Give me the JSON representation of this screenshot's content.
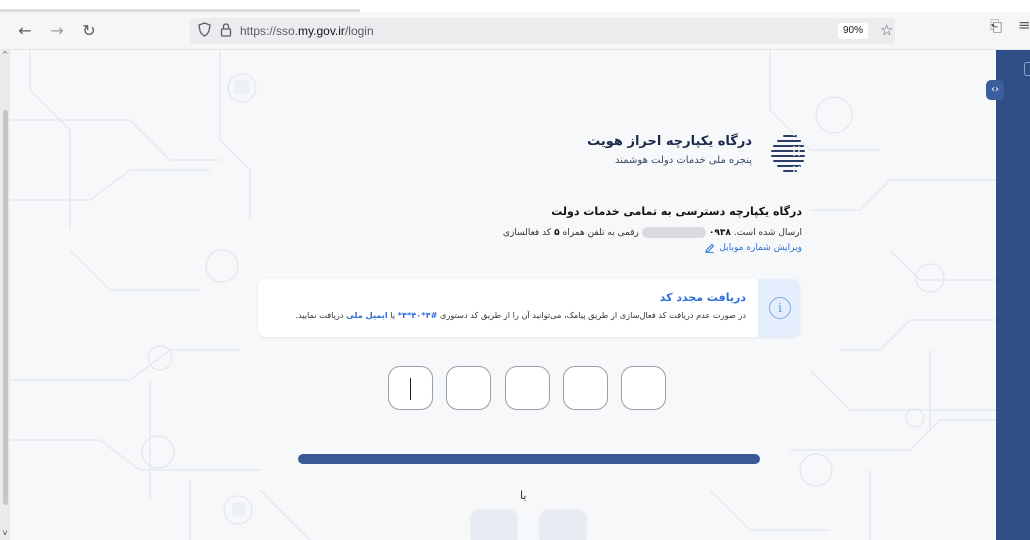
{
  "browser": {
    "url_prefix": "https://sso.",
    "url_domain": "my.gov.ir",
    "url_path": "/login",
    "zoom": "90%",
    "icons": {
      "back": "arrow-left-icon",
      "forward": "arrow-right-icon",
      "reload": "reload-icon",
      "shield": "shield-icon",
      "lock": "lock-icon",
      "bookmark": "star-icon",
      "extensions": "extensions-icon",
      "menu": "menu-icon"
    }
  },
  "brand": {
    "title": "درگاه یکپارچه احراز هویت",
    "subtitle": "پنجره ملی خدمات دولت هوشمند"
  },
  "main": {
    "heading": "درگاه یکپارچه دسترسی به تمامی خدمات دولت",
    "sent_prefix": "کد فعالسازی",
    "digits": "۵",
    "sent_mid": "رقمی به تلفن همراه",
    "phone_prefix": "۰۹۳۸",
    "sent_suffix": "ارسال شده است.",
    "edit_link": "ویرایش شماره موبایل"
  },
  "info": {
    "title": "دریافت مجدد کد",
    "text_a": "در صورت عدم دریافت کد فعال‌سازی از طریق پیامک، می‌توانید آن را از طریق کد دستوری",
    "ussd": "#۴*۴۰*۴*",
    "text_b": "یا",
    "email": "ایمیل ملی",
    "text_c": "دریافت نمایید."
  },
  "otp": {
    "box_count": 5
  },
  "footer": {
    "or_label": "یا"
  },
  "colors": {
    "accent": "#2f6fd6",
    "primary_bar": "#3a5a95",
    "side_panel": "#2e4e85"
  }
}
